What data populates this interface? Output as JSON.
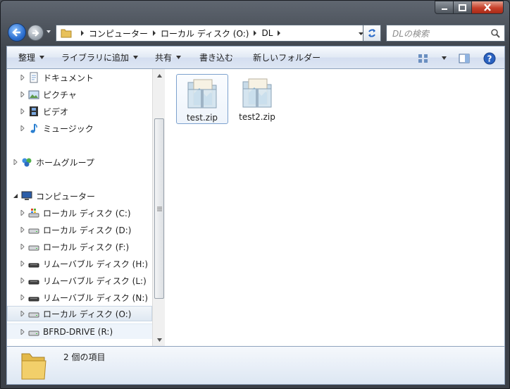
{
  "navigation": {
    "breadcrumbs": [
      "コンピューター",
      "ローカル ディスク (O:)",
      "DL"
    ]
  },
  "search": {
    "placeholder": "DLの検索"
  },
  "toolbar": {
    "organize": "整理",
    "include_in_library": "ライブラリに追加",
    "share": "共有",
    "burn": "書き込む",
    "new_folder": "新しいフォルダー"
  },
  "nav_pane": {
    "libraries": [
      {
        "label": "ドキュメント",
        "icon": "documents-icon"
      },
      {
        "label": "ピクチャ",
        "icon": "pictures-icon"
      },
      {
        "label": "ビデオ",
        "icon": "videos-icon"
      },
      {
        "label": "ミュージック",
        "icon": "music-icon"
      }
    ],
    "homegroup": {
      "label": "ホームグループ",
      "icon": "homegroup-icon"
    },
    "computer": {
      "label": "コンピューター",
      "icon": "computer-icon"
    },
    "drives": [
      {
        "label": "ローカル ディスク (C:)",
        "icon": "system-drive-icon"
      },
      {
        "label": "ローカル ディスク (D:)",
        "icon": "hard-drive-icon"
      },
      {
        "label": "ローカル ディスク (F:)",
        "icon": "hard-drive-icon"
      },
      {
        "label": "リムーバブル ディスク (H:)",
        "icon": "removable-drive-icon"
      },
      {
        "label": "リムーバブル ディスク (L:)",
        "icon": "removable-drive-icon"
      },
      {
        "label": "リムーバブル ディスク (N:)",
        "icon": "removable-drive-icon"
      },
      {
        "label": "ローカル ディスク (O:)",
        "icon": "hard-drive-icon"
      },
      {
        "label": "BFRD-DRIVE (R:)",
        "icon": "hard-drive-icon"
      }
    ]
  },
  "files": [
    {
      "name": "test.zip",
      "icon": "zip-folder-icon"
    },
    {
      "name": "test2.zip",
      "icon": "zip-folder-icon"
    }
  ],
  "status": {
    "item_count": "2 個の項目"
  },
  "colors": {
    "toolbar_border": "#8fa3bd",
    "selection": "#7da2ce",
    "frame": "#3f454d"
  }
}
